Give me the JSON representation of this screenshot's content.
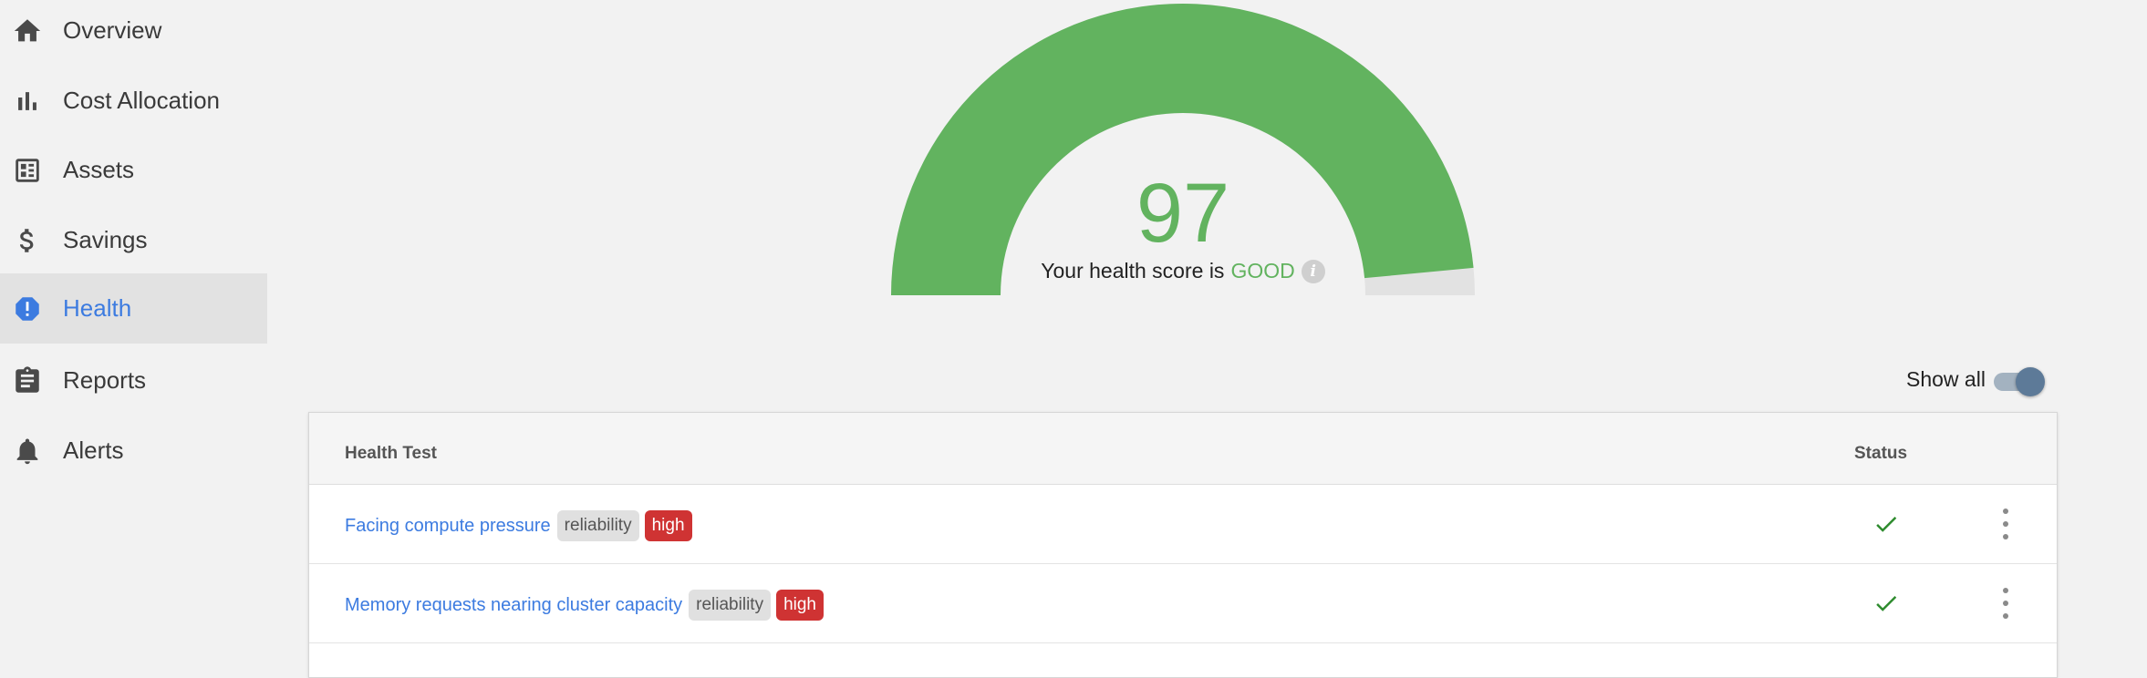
{
  "sidebar": {
    "items": [
      {
        "label": "Overview",
        "icon": "home-icon"
      },
      {
        "label": "Cost Allocation",
        "icon": "bar-chart-icon"
      },
      {
        "label": "Assets",
        "icon": "dashboard-icon"
      },
      {
        "label": "Savings",
        "icon": "dollar-icon"
      },
      {
        "label": "Health",
        "icon": "alert-circle-icon",
        "active": true
      },
      {
        "label": "Reports",
        "icon": "clipboard-icon"
      },
      {
        "label": "Alerts",
        "icon": "bell-icon"
      }
    ]
  },
  "health": {
    "score": "97",
    "score_fraction": 0.97,
    "caption_prefix": "Your health score is",
    "rating": "GOOD",
    "gauge_color": "#62b35f",
    "gauge_track_color": "#e2e2e2"
  },
  "controls": {
    "show_all_label": "Show all",
    "show_all_on": true
  },
  "table": {
    "columns": {
      "test": "Health Test",
      "status": "Status"
    },
    "rows": [
      {
        "name": "Facing compute pressure",
        "category": "reliability",
        "severity": "high",
        "status": "pass"
      },
      {
        "name": "Memory requests nearing cluster capacity",
        "category": "reliability",
        "severity": "high",
        "status": "pass"
      }
    ]
  },
  "colors": {
    "accent": "#3c7be0",
    "good": "#62b35f",
    "severity_high": "#cf3333",
    "check": "#2e8b2e"
  }
}
